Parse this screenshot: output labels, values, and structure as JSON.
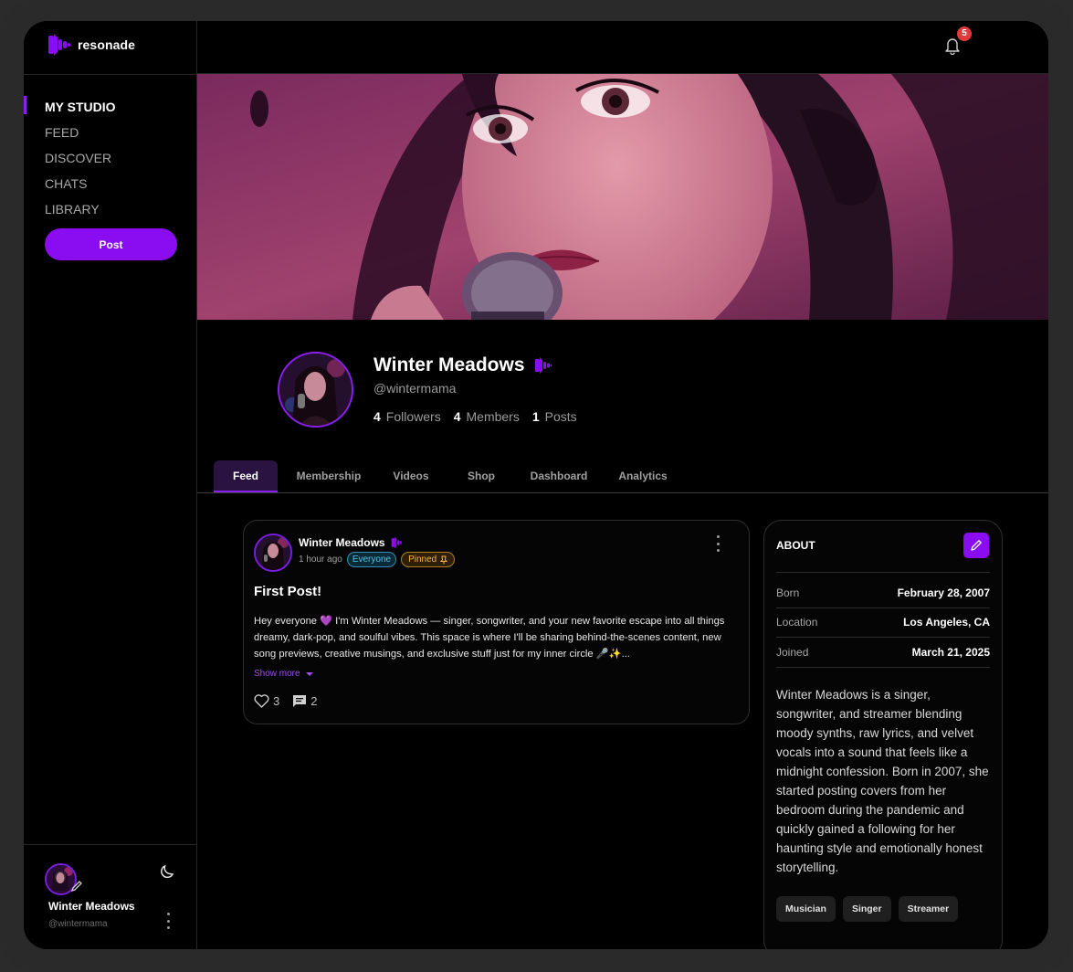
{
  "app": {
    "logo_text": "resonade"
  },
  "sidebar": {
    "items": [
      {
        "label": "MY STUDIO",
        "active": true
      },
      {
        "label": "FEED",
        "active": false
      },
      {
        "label": "DISCOVER",
        "active": false
      },
      {
        "label": "CHATS",
        "active": false
      },
      {
        "label": "LIBRARY",
        "active": false
      }
    ],
    "post_button": "Post",
    "user": {
      "name": "Winter Meadows",
      "handle": "@wintermama"
    }
  },
  "topbar": {
    "notification_count": "5"
  },
  "profile": {
    "name": "Winter Meadows",
    "handle": "@wintermama",
    "stats": [
      {
        "value": "4",
        "label": "Followers"
      },
      {
        "value": "4",
        "label": "Members"
      },
      {
        "value": "1",
        "label": "Posts"
      }
    ]
  },
  "tabs": [
    "Feed",
    "Membership",
    "Videos",
    "Shop",
    "Dashboard",
    "Analytics"
  ],
  "active_tab": "Feed",
  "post": {
    "author": "Winter Meadows",
    "time": "1 hour ago",
    "audience_badge": "Everyone",
    "pinned_badge": "Pinned",
    "title": "First Post!",
    "body": "Hey everyone 💜 I'm Winter Meadows — singer, songwriter, and your new favorite escape into all things dreamy, dark-pop, and soulful vibes. This space is where I'll be sharing behind-the-scenes content, new song previews, creative musings, and exclusive stuff just for my inner circle 🎤✨...",
    "show_more": "Show more",
    "likes": "3",
    "comments": "2"
  },
  "about": {
    "title": "ABOUT",
    "rows": [
      {
        "key": "Born",
        "value": "February 28, 2007"
      },
      {
        "key": "Location",
        "value": "Los Angeles, CA"
      },
      {
        "key": "Joined",
        "value": "March 21, 2025"
      }
    ],
    "bio": "Winter Meadows is a singer, songwriter, and streamer blending moody synths, raw lyrics, and velvet vocals into a sound that feels like a midnight confession. Born in 2007, she started posting covers from her bedroom during the pandemic and quickly gained a following for her haunting style and emotionally honest storytelling.",
    "tags": [
      "Musician",
      "Singer",
      "Streamer"
    ]
  },
  "colors": {
    "accent": "#8a0cf0",
    "badge_red": "#e23a3a",
    "everyone": "#4fc3e8",
    "pinned": "#f0b44a"
  },
  "icons": [
    "logo-icon",
    "bell-icon",
    "moon-icon",
    "verified-wave-icon",
    "pin-icon",
    "heart-icon",
    "comment-icon",
    "pencil-icon",
    "kebab-icon",
    "chevron-down-icon"
  ]
}
